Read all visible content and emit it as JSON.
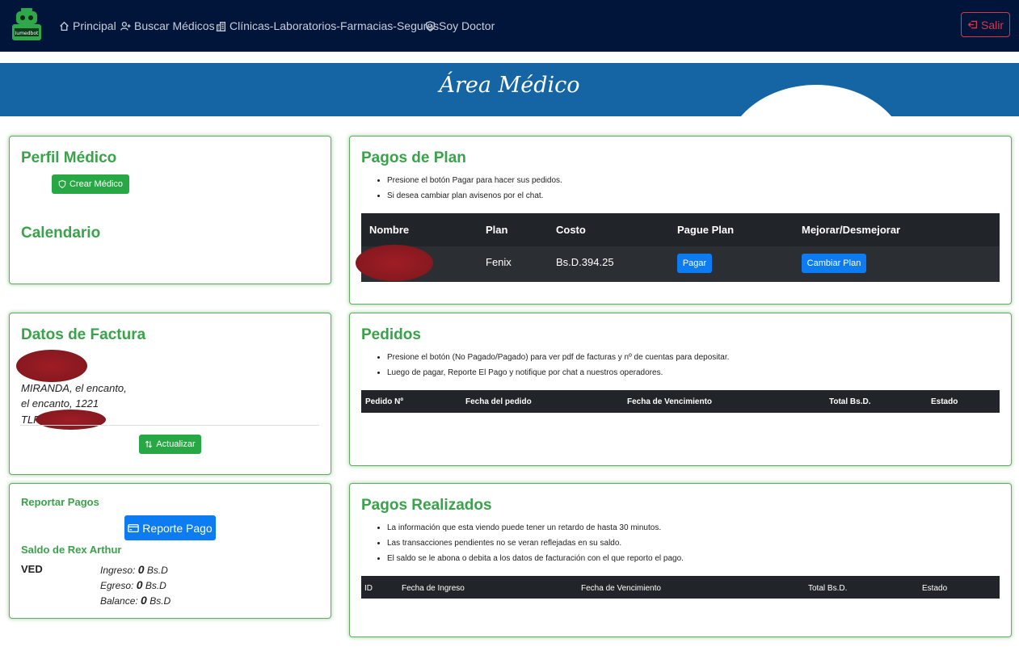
{
  "nav": {
    "logo_text": "Iumedbot",
    "items": [
      {
        "label": "Principal",
        "icon": "home-icon"
      },
      {
        "label": "Buscar Médicos",
        "icon": "user-plus-icon"
      },
      {
        "label": "Clínicas-Laboratorios-Farmacias-Seguros",
        "icon": "building-icon"
      },
      {
        "label": "Soy Doctor",
        "icon": "shield-icon"
      }
    ],
    "logout_label": "Salir"
  },
  "hero": {
    "title": "Área Médico"
  },
  "perfil": {
    "title": "Perfil Médico",
    "button": "Crear Médico",
    "calendar_title": "Calendario"
  },
  "factura": {
    "title": "Datos de Factura",
    "line1": "MIRANDA, el encanto,",
    "line2": "el encanto, 1221",
    "line3": "TLF",
    "button": "Actualizar"
  },
  "reporte": {
    "title": "Reportar Pagos",
    "button": "Reporte Pago",
    "saldo_title": "Saldo de Rex Arthur",
    "currency": "VED",
    "ingreso_label": "Ingreso:",
    "ingreso_value": "0",
    "egreso_label": "Egreso:",
    "egreso_value": "0",
    "balance_label": "Balance:",
    "balance_value": "0",
    "unit": "Bs.D"
  },
  "plan": {
    "title": "Pagos de Plan",
    "notes": [
      "Presione el botón Pagar para hacer sus pedidos.",
      "Si desea cambiar plan avisenos por el chat."
    ],
    "headers": [
      "Nombre",
      "Plan",
      "Costo",
      "Pague Plan",
      "Mejorar/Desmejorar"
    ],
    "row": {
      "plan": "Fenix",
      "costo": "Bs.D.394.25",
      "pay_button": "Pagar",
      "change_button": "Cambiar Plan"
    }
  },
  "pedidos": {
    "title": "Pedidos",
    "notes": [
      "Presione el botón (No Pagado/Pagado) para ver pdf de facturas y nº de cuentas para depositar.",
      "Luego de pagar, Reporte El Pago y notifique por chat a nuestros operadores."
    ],
    "headers": [
      "Pedido Nº",
      "Fecha del pedido",
      "Fecha de Vencimiento",
      "Total Bs.D.",
      "Estado"
    ]
  },
  "realizados": {
    "title": "Pagos Realizados",
    "notes": [
      "La información que esta viendo puede tener un retardo de hasta 30 minutos.",
      "Las transacciones pendientes no se veran reflejadas en su saldo.",
      "El saldo se le abona o debita a los datos de facturación con el que reporto el pago."
    ],
    "headers": [
      "ID",
      "Fecha de Ingreso",
      "Fecha de Vencimiento",
      "Total Bs.D.",
      "Estado"
    ]
  },
  "colors": {
    "navbar": "#01153b",
    "hero": "#1565a4",
    "accent_green": "#3aa24a",
    "button_blue": "#0d7cf2",
    "danger": "#dc3545"
  }
}
